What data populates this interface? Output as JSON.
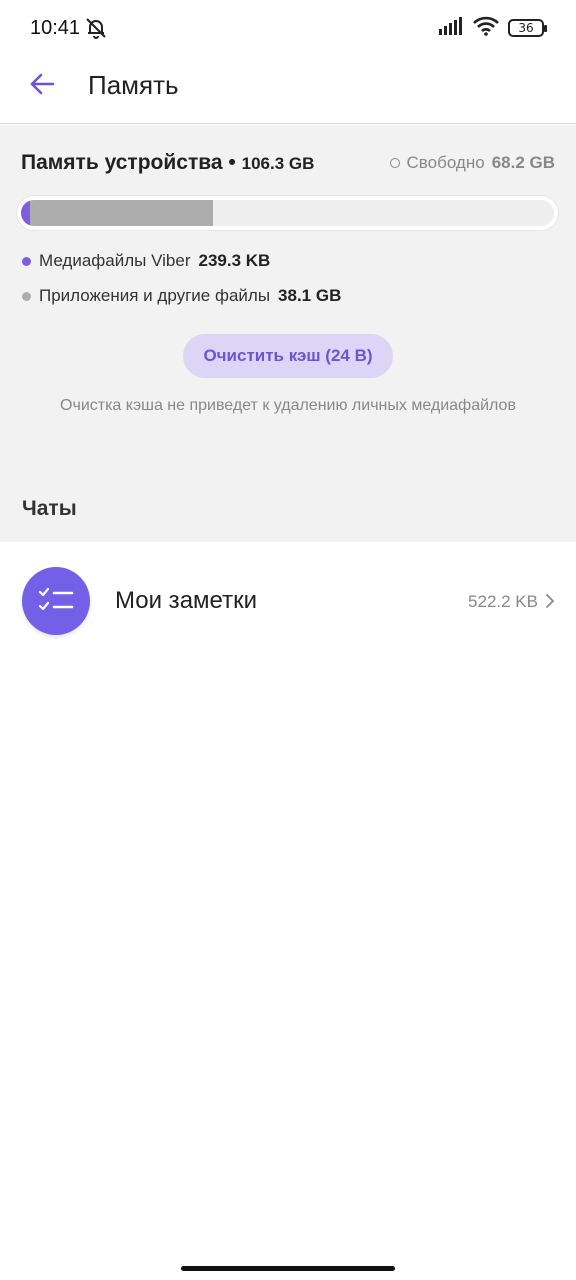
{
  "status_bar": {
    "time": "10:41",
    "battery": "36",
    "icons": [
      "bell-muted-icon",
      "signal-icon",
      "wifi-icon",
      "battery-icon"
    ]
  },
  "app_bar": {
    "title": "Память",
    "back_icon": "arrow-left-icon"
  },
  "storage": {
    "device_label": "Память устройства",
    "separator": "•",
    "device_total": "106.3 GB",
    "free_label": "Свободно",
    "free_value": "68.2 GB",
    "usage_fractions": {
      "viber": 0.01,
      "other": 0.36
    },
    "legend": [
      {
        "label": "Медиафайлы Viber",
        "value": "239.3 KB",
        "color": "#7f5ce0"
      },
      {
        "label": "Приложения и другие файлы",
        "value": "38.1 GB",
        "color": "#adadad"
      }
    ],
    "clear_cache_label": "Очистить кэш (24 B)",
    "cache_note": "Очистка кэша не приведет к удалению личных медиафайлов"
  },
  "chats": {
    "heading": "Чаты",
    "items": [
      {
        "name": "Мои заметки",
        "size": "522.2 KB",
        "icon": "checklist-icon"
      }
    ]
  },
  "colors": {
    "accent": "#7360e6",
    "accent_light": "#ddd5f6",
    "section_bg": "#f2f2f2"
  }
}
